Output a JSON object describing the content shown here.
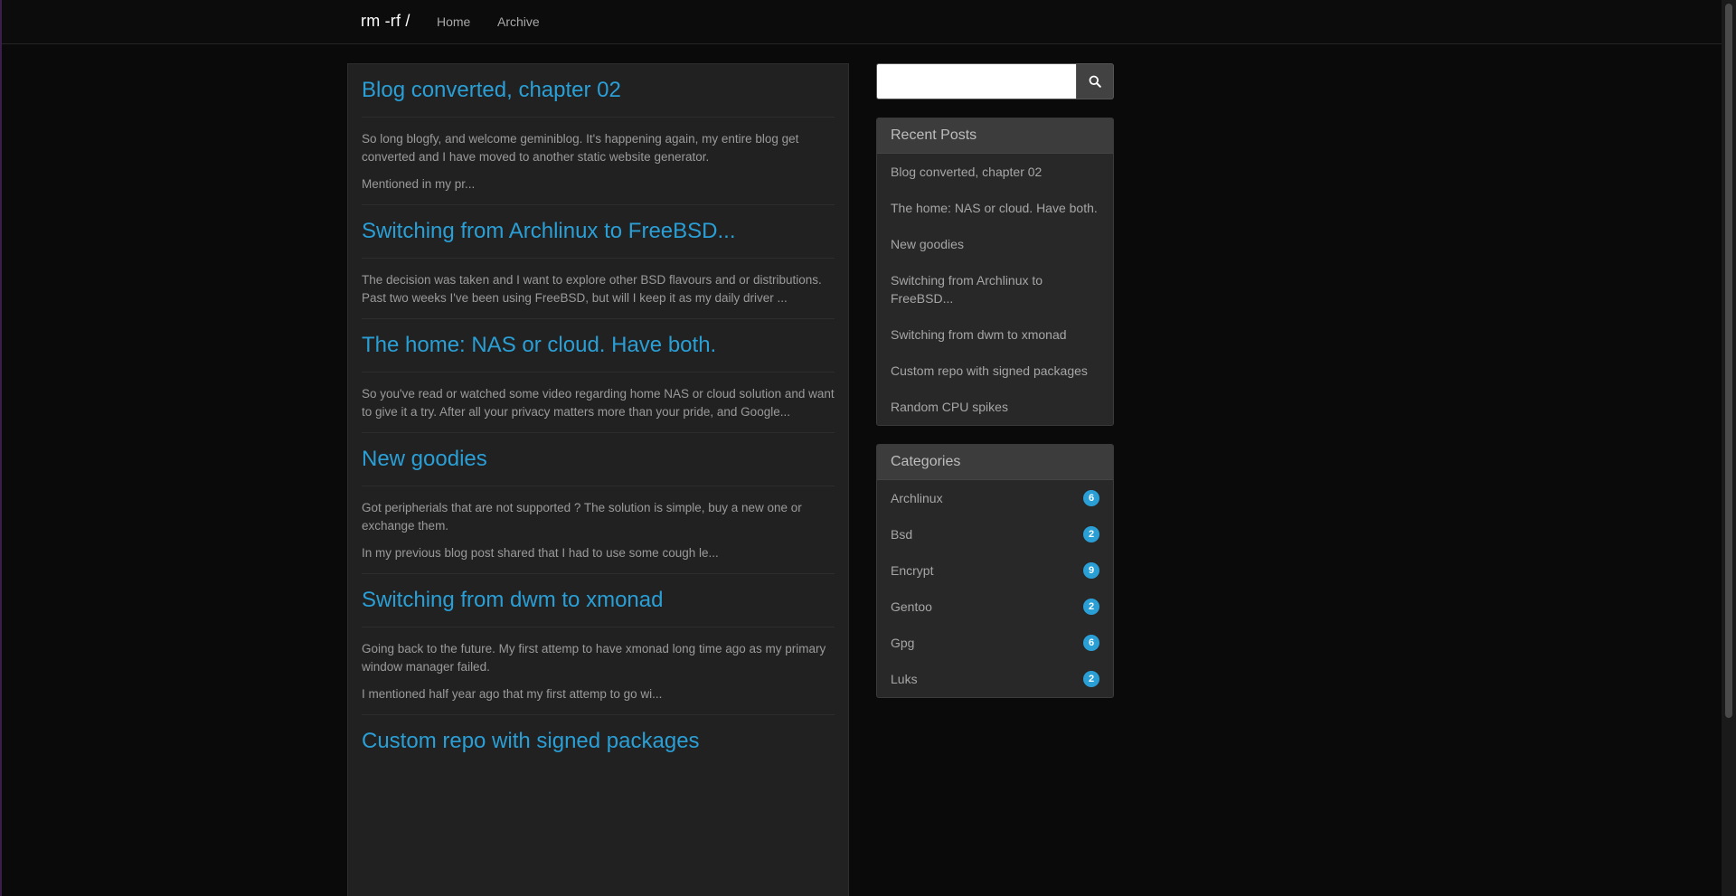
{
  "nav": {
    "brand": "rm -rf /",
    "links": [
      "Home",
      "Archive"
    ]
  },
  "posts": [
    {
      "title": "Blog converted, chapter 02",
      "paragraphs": [
        "So long blogfy, and welcome geminiblog. It's happening again, my entire blog get converted and I have moved to another static website generator.",
        "Mentioned in my pr..."
      ]
    },
    {
      "title": "Switching from Archlinux to FreeBSD...",
      "paragraphs": [
        "The decision was taken and I want to explore other BSD flavours and or distributions. Past two weeks I've been using FreeBSD, but will I keep it as my daily driver ..."
      ]
    },
    {
      "title": "The home: NAS or cloud. Have both.",
      "paragraphs": [
        "So you've read or watched some video regarding home NAS or cloud solution and want to give it a try. After all your privacy matters more than your pride, and Google..."
      ]
    },
    {
      "title": "New goodies",
      "paragraphs": [
        "Got peripherials that are not supported ? The solution is simple, buy a new one or exchange them.",
        "In my previous blog post shared that I had to use some cough le..."
      ]
    },
    {
      "title": "Switching from dwm to xmonad",
      "paragraphs": [
        "Going back to the future. My first attemp to have xmonad long time ago as my primary window manager failed.",
        "I mentioned half year ago that my first attemp to go wi..."
      ]
    },
    {
      "title": "Custom repo with signed packages",
      "paragraphs": []
    }
  ],
  "search": {
    "placeholder": "",
    "button_icon": "search-icon"
  },
  "recent_posts": {
    "heading": "Recent Posts",
    "items": [
      "Blog converted, chapter 02",
      "The home: NAS or cloud. Have both.",
      "New goodies",
      "Switching from Archlinux to FreeBSD...",
      "Switching from dwm to xmonad",
      "Custom repo with signed packages",
      "Random CPU spikes"
    ]
  },
  "categories": {
    "heading": "Categories",
    "items": [
      {
        "name": "Archlinux",
        "count": "6"
      },
      {
        "name": "Bsd",
        "count": "2"
      },
      {
        "name": "Encrypt",
        "count": "9"
      },
      {
        "name": "Gentoo",
        "count": "2"
      },
      {
        "name": "Gpg",
        "count": "6"
      },
      {
        "name": "Luks",
        "count": "2"
      }
    ]
  },
  "colors": {
    "accent": "#2a9fd6",
    "background": "#0a0a0a",
    "panel": "#212121"
  }
}
